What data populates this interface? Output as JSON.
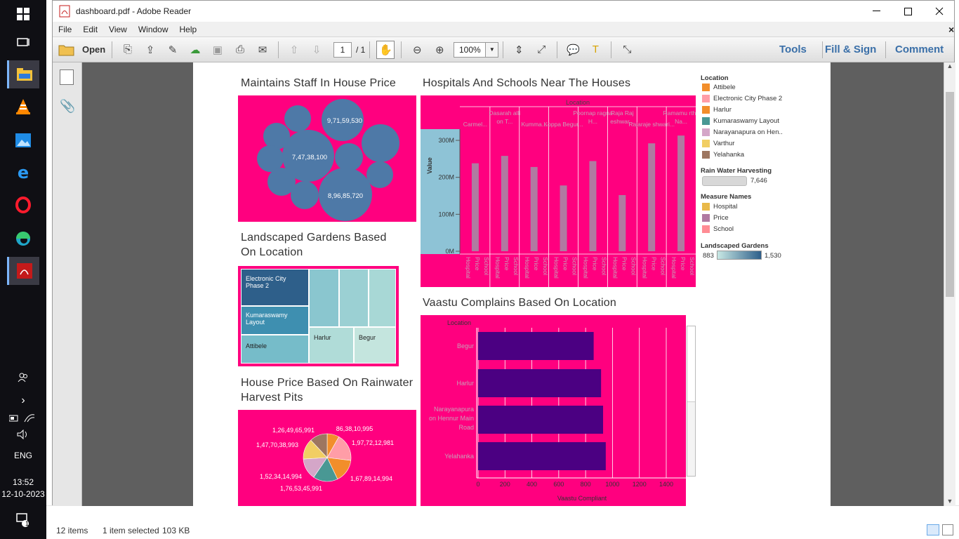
{
  "window": {
    "title": "dashboard.pdf - Adobe Reader",
    "close_doc": "×"
  },
  "menu": [
    "File",
    "Edit",
    "View",
    "Window",
    "Help"
  ],
  "toolbar": {
    "open_label": "Open",
    "page_value": "1",
    "page_total": "/ 1",
    "zoom": "100%",
    "tools": "Tools",
    "fill_sign": "Fill & Sign",
    "comment": "Comment"
  },
  "taskbar": {
    "lang": "ENG",
    "time": "13:52",
    "date": "12-10-2023",
    "notif_count": "1"
  },
  "explorer": {
    "items": "12 items",
    "selected": "1 item selected",
    "size": "103 KB"
  },
  "colors": {
    "pink": "#ff007f",
    "bubble": "#4e79a7",
    "bar_purple": "#4b0082",
    "mauve": "#b07aa1"
  },
  "sheet1": {
    "title": "Maintains Staff In House Price",
    "labels": [
      "9,71,59,530",
      "7,47,38,100",
      "8,96,85,720"
    ]
  },
  "sheet2": {
    "title": "Hospitals And Schools Near The Houses",
    "col_header": "Location",
    "locations": [
      "Carmel...",
      "Dasarah alli on T...",
      "Kumma...",
      "Koppa Begur...",
      "Poornap ragna H...",
      "Raja Raj eshwar...",
      "Rajaraje shwari...",
      "Ramamu rthy Na..."
    ],
    "ylabel": "Value",
    "yticks": [
      "300M",
      "200M",
      "100M",
      "0M"
    ],
    "measures": [
      "Hospital",
      "Price",
      "School"
    ]
  },
  "sheet3": {
    "title": "Landscaped Gardens Based On Location",
    "tiles": [
      "Electronic City Phase 2",
      "Kumaraswamy Layout",
      "Attibele",
      "Harlur",
      "Begur"
    ]
  },
  "sheet4": {
    "title": "House Price Based On Rainwater Harvest Pits",
    "labels": [
      "1,26,49,65,991",
      "86,38,10,995",
      "1,97,72,12,981",
      "1,47,70,38,993",
      "1,52,34,14,994",
      "1,76,53,45,991",
      "1,67,89,14,994"
    ]
  },
  "sheet5": {
    "title": "Vaastu Complains Based On Location",
    "row_header": "Location",
    "xlabel": "Vaastu Compliant",
    "xticks": [
      "0",
      "200",
      "400",
      "600",
      "800",
      "1000",
      "1200",
      "1400"
    ]
  },
  "legend": {
    "loc_title": "Location",
    "locations": [
      {
        "name": "Attibele",
        "color": "#f28e2b"
      },
      {
        "name": "Electronic City Phase 2",
        "color": "#ff9da7"
      },
      {
        "name": "Harlur",
        "color": "#f28e2b"
      },
      {
        "name": "Kumaraswamy Layout",
        "color": "#499894"
      },
      {
        "name": "Narayanapura on Hen..",
        "color": "#d4a6c8"
      },
      {
        "name": "Varthur",
        "color": "#f1ce63"
      },
      {
        "name": "Yelahanka",
        "color": "#9d7660"
      }
    ],
    "rain_title": "Rain Water Harvesting",
    "rain_value": "7,646",
    "measure_title": "Measure Names",
    "measures": [
      {
        "name": "Hospital",
        "color": "#e9b949"
      },
      {
        "name": "Price",
        "color": "#b07aa1"
      },
      {
        "name": "School",
        "color": "#ff8c94"
      }
    ],
    "garden_title": "Landscaped Gardens",
    "garden_min": "883",
    "garden_max": "1,530"
  },
  "chart_data": [
    {
      "type": "scatter",
      "title": "Maintains Staff In House Price",
      "labels": [
        "9,71,59,530",
        "7,47,38,100",
        "8,96,85,720"
      ]
    },
    {
      "type": "bar",
      "title": "Hospitals And Schools Near The Houses",
      "categories": [
        "Carmel...",
        "Dasarah alli on T...",
        "Kumma...",
        "Koppa Begur...",
        "Poornap ragna H...",
        "Raja Raj eshwar...",
        "Rajaraje shwari...",
        "Ramamu rthy Na..."
      ],
      "series": [
        {
          "name": "Price",
          "values": [
            238,
            258,
            228,
            178,
            244,
            152,
            292,
            313
          ]
        }
      ],
      "ylabel": "Value",
      "ylim": [
        0,
        330
      ]
    },
    {
      "type": "bar",
      "title": "Vaastu Complains Based On Location",
      "categories": [
        "Begur",
        "Harlur",
        "Narayanapura on Hennur Main Road",
        "Yelahanka"
      ],
      "values": [
        860,
        915,
        930,
        950
      ],
      "xlabel": "Vaastu Compliant",
      "xlim": [
        0,
        1500
      ]
    },
    {
      "type": "pie",
      "title": "House Price Based On Rainwater Harvest Pits",
      "values": [
        8638,
        19772,
        16789,
        17653,
        15234,
        14770,
        12649
      ]
    }
  ]
}
